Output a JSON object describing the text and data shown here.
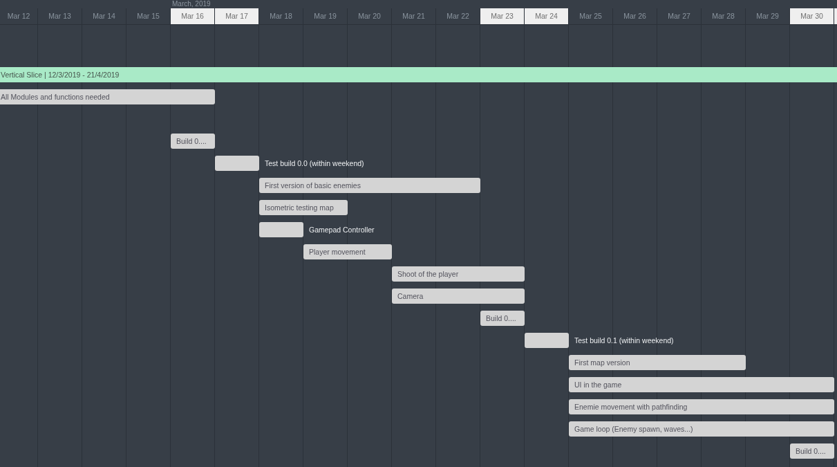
{
  "timeline": {
    "month": "March, 2019",
    "days": [
      {
        "label": "Mar 12",
        "weekend": false
      },
      {
        "label": "Mar 13",
        "weekend": false
      },
      {
        "label": "Mar 14",
        "weekend": false
      },
      {
        "label": "Mar 15",
        "weekend": false
      },
      {
        "label": "Mar 16",
        "weekend": true
      },
      {
        "label": "Mar 17",
        "weekend": true
      },
      {
        "label": "Mar 18",
        "weekend": false
      },
      {
        "label": "Mar 19",
        "weekend": false
      },
      {
        "label": "Mar 20",
        "weekend": false
      },
      {
        "label": "Mar 21",
        "weekend": false
      },
      {
        "label": "Mar 22",
        "weekend": false
      },
      {
        "label": "Mar 23",
        "weekend": true
      },
      {
        "label": "Mar 24",
        "weekend": true
      },
      {
        "label": "Mar 25",
        "weekend": false
      },
      {
        "label": "Mar 26",
        "weekend": false
      },
      {
        "label": "Mar 27",
        "weekend": false
      },
      {
        "label": "Mar 28",
        "weekend": false
      },
      {
        "label": "Mar 29",
        "weekend": false
      },
      {
        "label": "Mar 30",
        "weekend": true
      },
      {
        "weekend": true
      }
    ]
  },
  "project": {
    "label": "Vertical Slice | 12/3/2019 - 21/4/2019"
  },
  "tasks": [
    {
      "label": "All Modules and functions needed",
      "kind": "inner"
    },
    {
      "label": "Build 0....",
      "kind": "inner"
    },
    {
      "label": "Test build 0.0 (within weekend)",
      "kind": "outer"
    },
    {
      "label": "First version of basic enemies",
      "kind": "inner"
    },
    {
      "label": "Isometric testing map",
      "kind": "inner"
    },
    {
      "label": "Gamepad Controller",
      "kind": "outer"
    },
    {
      "label": "Player movement",
      "kind": "inner"
    },
    {
      "label": "Shoot of the player",
      "kind": "inner"
    },
    {
      "label": "Camera",
      "kind": "inner"
    },
    {
      "label": "Build 0....",
      "kind": "inner"
    },
    {
      "label": "Test build 0.1 (within weekend)",
      "kind": "outer"
    },
    {
      "label": "First map version",
      "kind": "inner"
    },
    {
      "label": "UI in the game",
      "kind": "inner"
    },
    {
      "label": "Enemie movement with pathfinding",
      "kind": "inner"
    },
    {
      "label": "Game loop (Enemy spawn, waves...)",
      "kind": "inner"
    },
    {
      "label": "Build 0....",
      "kind": "inner"
    }
  ]
}
